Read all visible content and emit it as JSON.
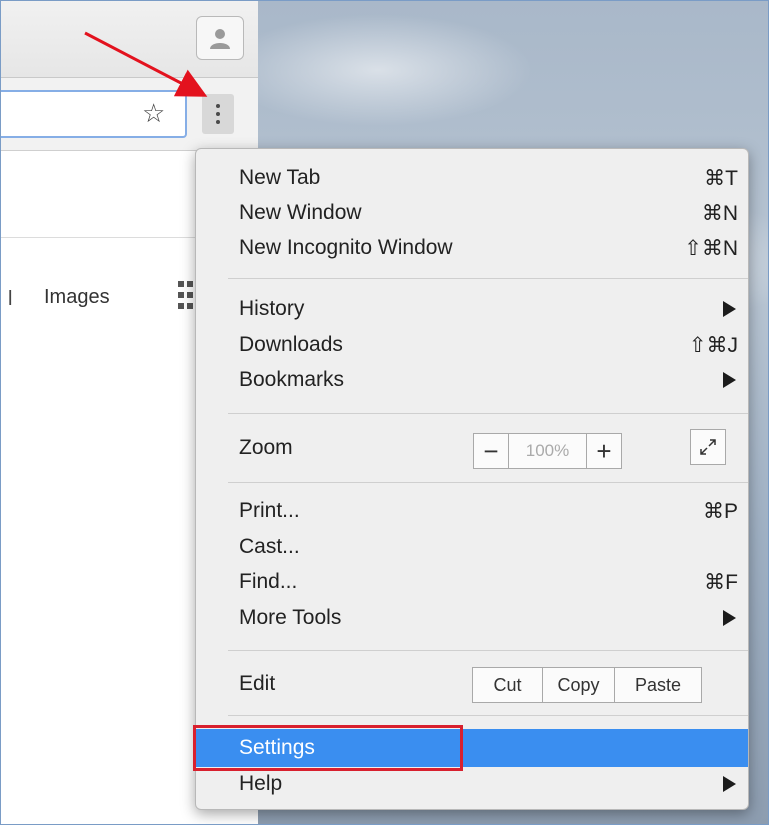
{
  "colors": {
    "highlight": "#3a8ef0",
    "annotation_red": "#d8202e",
    "omnibox_border": "#86aee6"
  },
  "icons": {
    "profile": "person-icon",
    "bookmark": "star-icon",
    "menu": "three-dots-menu-icon",
    "apps": "apps-grid-icon",
    "fullscreen": "fullscreen-icon",
    "submenu": "triangle-right-icon"
  },
  "page": {
    "link_partial": "l",
    "images_link": "Images"
  },
  "menu": {
    "new_tab": {
      "label": "New Tab",
      "shortcut": "⌘T"
    },
    "new_window": {
      "label": "New Window",
      "shortcut": "⌘N"
    },
    "new_incognito": {
      "label": "New Incognito Window",
      "shortcut": "⇧⌘N"
    },
    "history": {
      "label": "History"
    },
    "downloads": {
      "label": "Downloads",
      "shortcut": "⇧⌘J"
    },
    "bookmarks": {
      "label": "Bookmarks"
    },
    "zoom": {
      "label": "Zoom",
      "minus": "−",
      "level": "100%",
      "plus": "+"
    },
    "print": {
      "label": "Print...",
      "shortcut": "⌘P"
    },
    "cast": {
      "label": "Cast..."
    },
    "find": {
      "label": "Find...",
      "shortcut": "⌘F"
    },
    "more_tools": {
      "label": "More Tools"
    },
    "edit": {
      "label": "Edit",
      "cut": "Cut",
      "copy": "Copy",
      "paste": "Paste"
    },
    "settings": {
      "label": "Settings"
    },
    "help": {
      "label": "Help"
    }
  }
}
